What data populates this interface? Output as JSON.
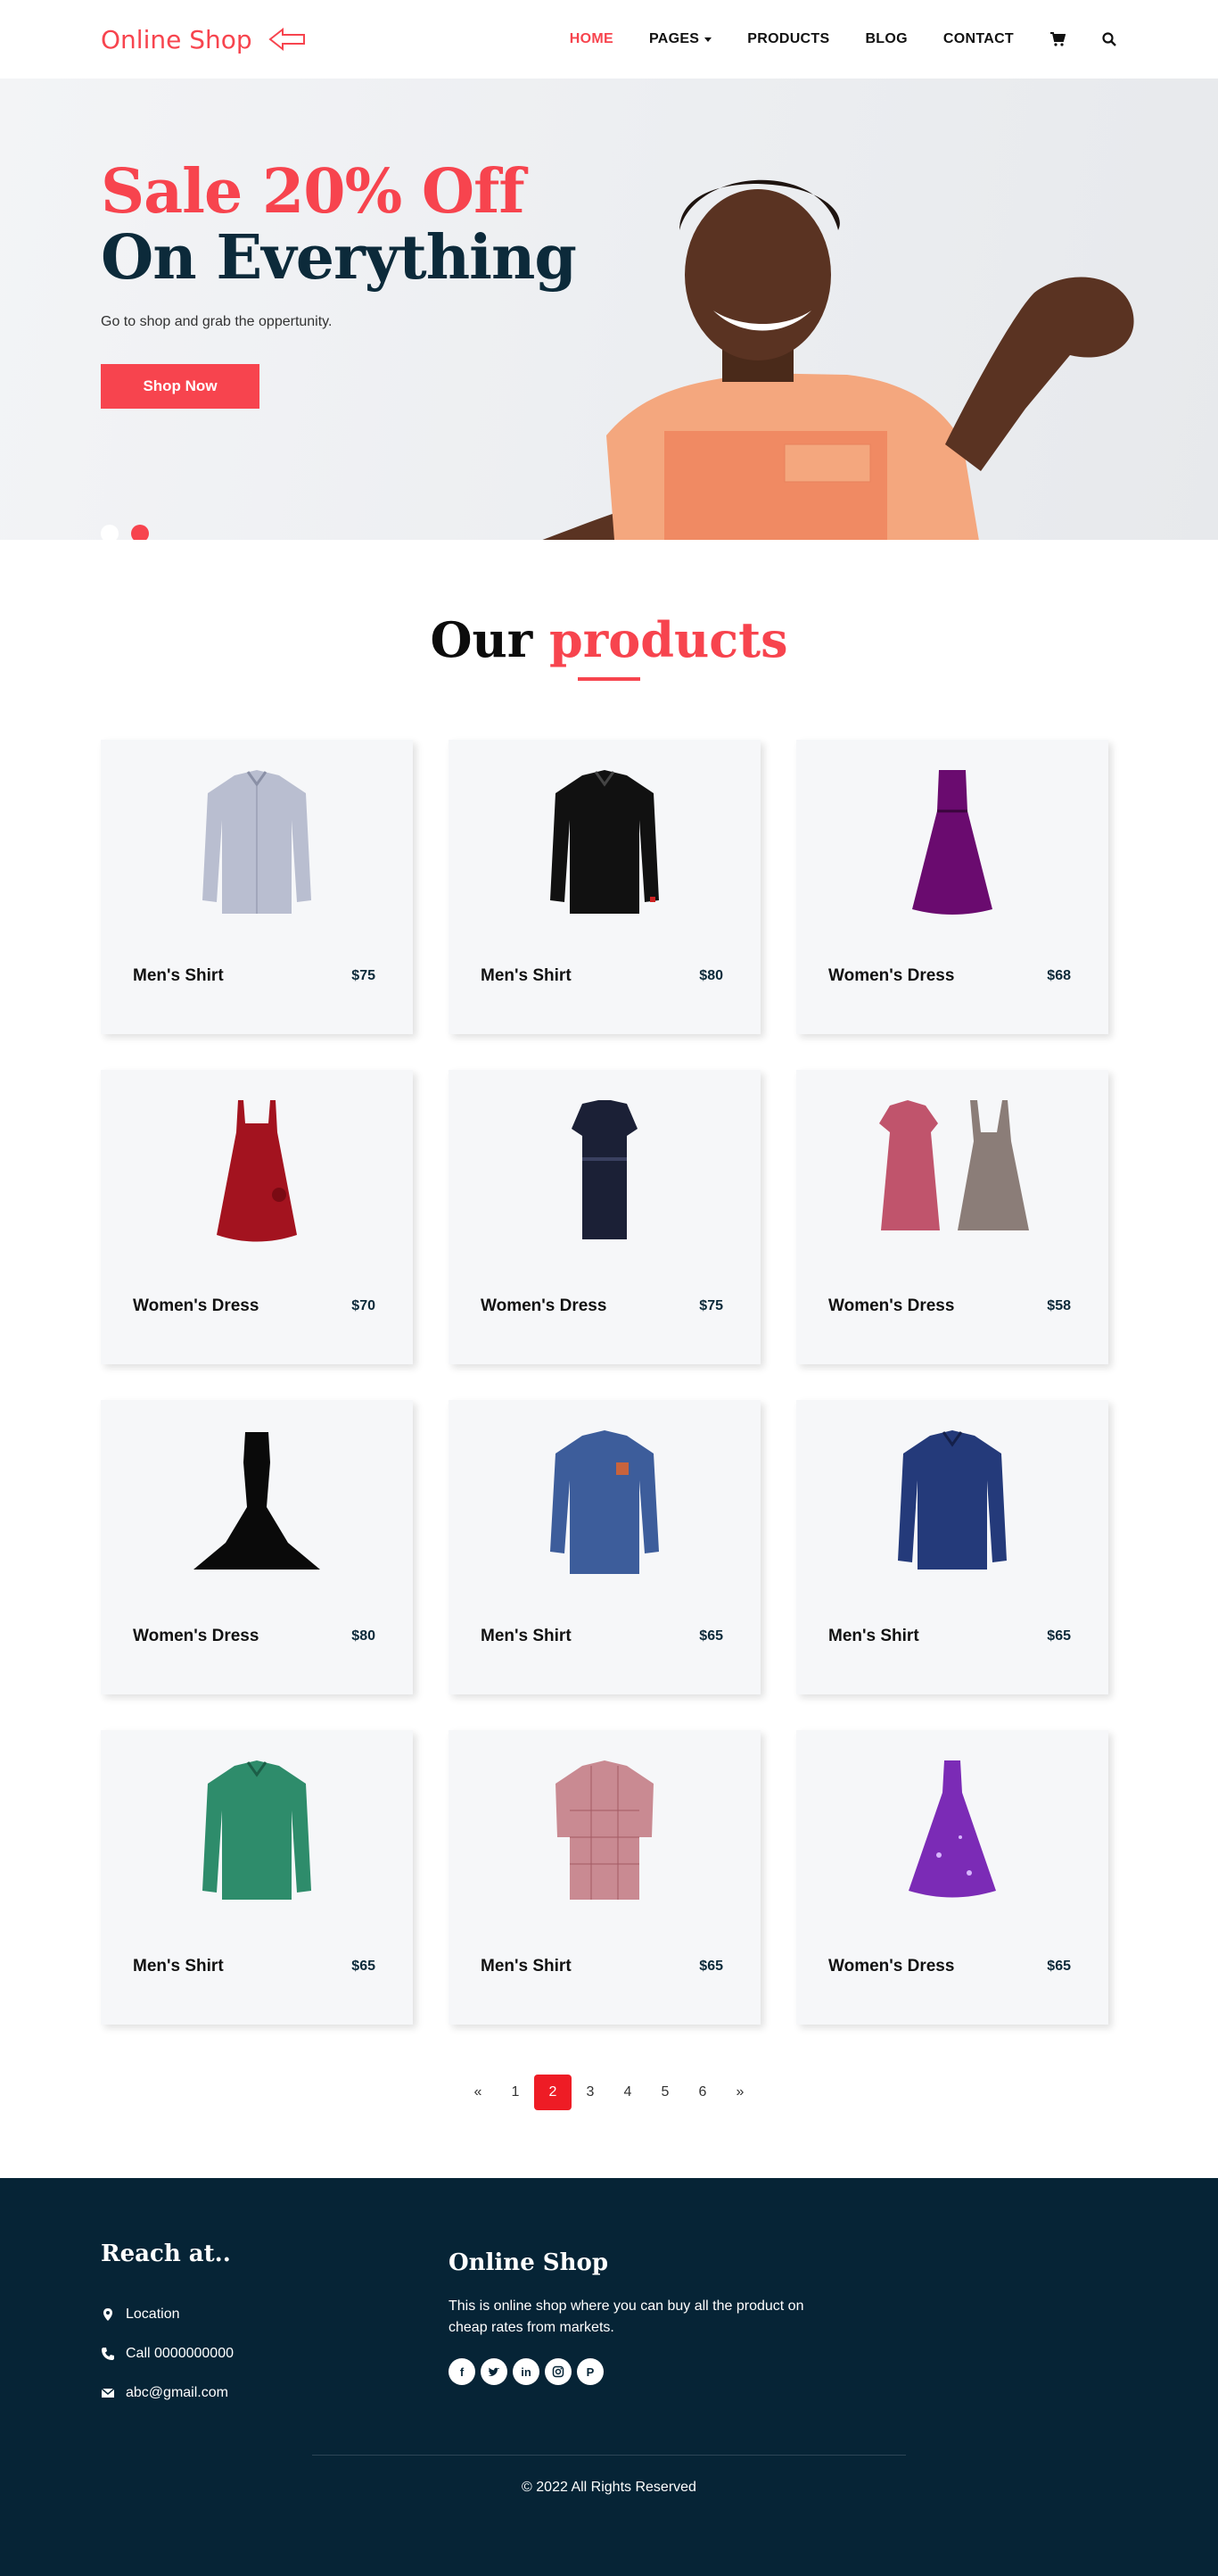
{
  "header": {
    "logo": "Online Shop",
    "nav": [
      "HOME",
      "PAGES",
      "PRODUCTS",
      "BLOG",
      "CONTACT"
    ],
    "icons": [
      "cart-icon",
      "search-icon"
    ],
    "accent_color": "#f7444e"
  },
  "hero": {
    "title_line1": "Sale 20% Off",
    "title_line2": "On Everything",
    "subtitle": "Go to shop and grab the oppertunity.",
    "button": "Shop Now",
    "slides": 2,
    "active_slide": 2
  },
  "products": {
    "title_part1": "Our",
    "title_part2": "products",
    "items": [
      {
        "name": "Men's Shirt",
        "price": "$75"
      },
      {
        "name": "Men's Shirt",
        "price": "$80"
      },
      {
        "name": "Women's Dress",
        "price": "$68"
      },
      {
        "name": "Women's Dress",
        "price": "$70"
      },
      {
        "name": "Women's Dress",
        "price": "$75"
      },
      {
        "name": "Women's Dress",
        "price": "$58"
      },
      {
        "name": "Women's Dress",
        "price": "$80"
      },
      {
        "name": "Men's Shirt",
        "price": "$65"
      },
      {
        "name": "Men's Shirt",
        "price": "$65"
      },
      {
        "name": "Men's Shirt",
        "price": "$65"
      },
      {
        "name": "Men's Shirt",
        "price": "$65"
      },
      {
        "name": "Women's Dress",
        "price": "$65"
      }
    ]
  },
  "pagination": {
    "prev": "«",
    "pages": [
      "1",
      "2",
      "3",
      "4",
      "5",
      "6"
    ],
    "next": "»",
    "current": "2"
  },
  "footer": {
    "reach_heading": "Reach at..",
    "location": "Location",
    "phone": "Call 0000000000",
    "email": "abc@gmail.com",
    "shop_heading": "Online Shop",
    "description": "This is online shop where you can buy all the product on cheap rates from markets.",
    "socials": [
      "facebook-icon",
      "twitter-icon",
      "linkedin-icon",
      "instagram-icon",
      "pinterest-icon"
    ],
    "copyright": "© 2022 All Rights Reserved",
    "background_color": "#062436"
  }
}
